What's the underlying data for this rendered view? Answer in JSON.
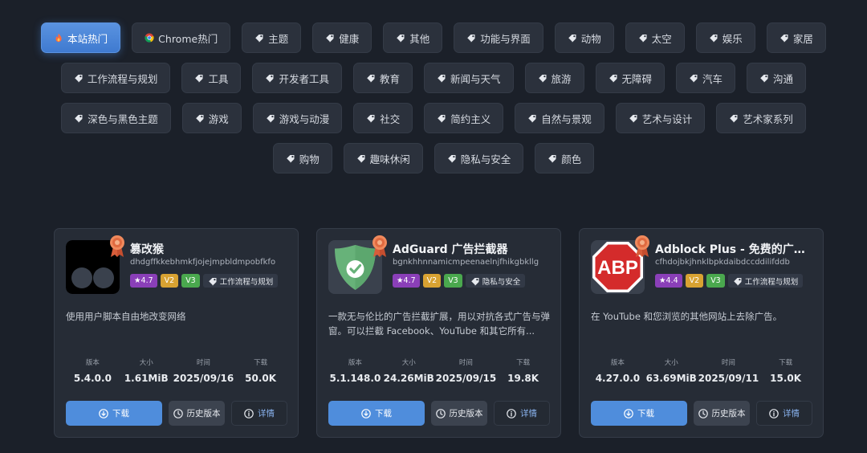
{
  "tags": [
    [
      {
        "label": "本站热门",
        "icon": "fire-icon",
        "active": true
      },
      {
        "label": "Chrome热门",
        "icon": "chrome-icon"
      },
      {
        "label": "主题",
        "icon": "tag-icon"
      },
      {
        "label": "健康",
        "icon": "tag-icon"
      },
      {
        "label": "其他",
        "icon": "tag-icon"
      },
      {
        "label": "功能与界面",
        "icon": "tag-icon"
      },
      {
        "label": "动物",
        "icon": "tag-icon"
      },
      {
        "label": "太空",
        "icon": "tag-icon"
      },
      {
        "label": "娱乐",
        "icon": "tag-icon"
      },
      {
        "label": "家居",
        "icon": "tag-icon"
      }
    ],
    [
      {
        "label": "工作流程与规划",
        "icon": "tag-icon"
      },
      {
        "label": "工具",
        "icon": "tag-icon"
      },
      {
        "label": "开发者工具",
        "icon": "tag-icon"
      },
      {
        "label": "教育",
        "icon": "tag-icon"
      },
      {
        "label": "新闻与天气",
        "icon": "tag-icon"
      },
      {
        "label": "旅游",
        "icon": "tag-icon"
      },
      {
        "label": "无障碍",
        "icon": "tag-icon"
      },
      {
        "label": "汽车",
        "icon": "tag-icon"
      },
      {
        "label": "沟通",
        "icon": "tag-icon"
      }
    ],
    [
      {
        "label": "深色与黑色主题",
        "icon": "tag-icon"
      },
      {
        "label": "游戏",
        "icon": "tag-icon"
      },
      {
        "label": "游戏与动漫",
        "icon": "tag-icon"
      },
      {
        "label": "社交",
        "icon": "tag-icon"
      },
      {
        "label": "简约主义",
        "icon": "tag-icon"
      },
      {
        "label": "自然与景观",
        "icon": "tag-icon"
      },
      {
        "label": "艺术与设计",
        "icon": "tag-icon"
      },
      {
        "label": "艺术家系列",
        "icon": "tag-icon"
      }
    ],
    [
      {
        "label": "购物",
        "icon": "tag-icon"
      },
      {
        "label": "趣味休闲",
        "icon": "tag-icon"
      },
      {
        "label": "隐私与安全",
        "icon": "tag-icon"
      },
      {
        "label": "颜色",
        "icon": "tag-icon"
      }
    ]
  ],
  "cards": [
    {
      "name": "篡改猴",
      "id": "dhdgffkkebhmkfjojejmpbldmpobfkfo",
      "logo": "tampermonkey-logo",
      "rating": "4.7",
      "v2": "V2",
      "v3": "V3",
      "category": "工作流程与规划",
      "description": "使用用户脚本自由地改变网络",
      "stats": [
        {
          "label": "版本",
          "value": "5.4.0.0"
        },
        {
          "label": "大小",
          "value": "1.61MiB"
        },
        {
          "label": "时间",
          "value": "2025/09/16"
        },
        {
          "label": "下载",
          "value": "50.0K"
        }
      ]
    },
    {
      "name": "AdGuard 广告拦截器",
      "id": "bgnkhhnnamicmpeenaelnjfhikgbkllg",
      "logo": "adguard-logo",
      "rating": "4.7",
      "v2": "V2",
      "v3": "V3",
      "category": "隐私与安全",
      "description": "一款无与伦比的广告拦截扩展，用以对抗各式广告与弹窗。可以拦截 Facebook、YouTube 和其它所有...",
      "stats": [
        {
          "label": "版本",
          "value": "5.1.148.0"
        },
        {
          "label": "大小",
          "value": "24.26MiB"
        },
        {
          "label": "时间",
          "value": "2025/09/15"
        },
        {
          "label": "下载",
          "value": "19.8K"
        }
      ]
    },
    {
      "name": "Adblock Plus - 免费的广告拦截器",
      "id": "cfhdojbkjhnklbpkdaibdccddilifddb",
      "logo": "adblock-plus-logo",
      "logo_text": "ABP",
      "rating": "4.4",
      "v2": "V2",
      "v3": "V3",
      "category": "工作流程与规划",
      "description": "在 YouTube 和您浏览的其他网站上去除广告。",
      "stats": [
        {
          "label": "版本",
          "value": "4.27.0.0"
        },
        {
          "label": "大小",
          "value": "63.69MiB"
        },
        {
          "label": "时间",
          "value": "2025/09/11"
        },
        {
          "label": "下载",
          "value": "15.0K"
        }
      ]
    }
  ],
  "buttons": {
    "download": "下载",
    "history": "历史版本",
    "details": "详情"
  },
  "colors": {
    "accent": "#4f8ddc",
    "background": "#1b2029",
    "card": "#262c36",
    "rating": "#8a3fb8",
    "v2": "#d8a232",
    "v3": "#4aa84e"
  }
}
